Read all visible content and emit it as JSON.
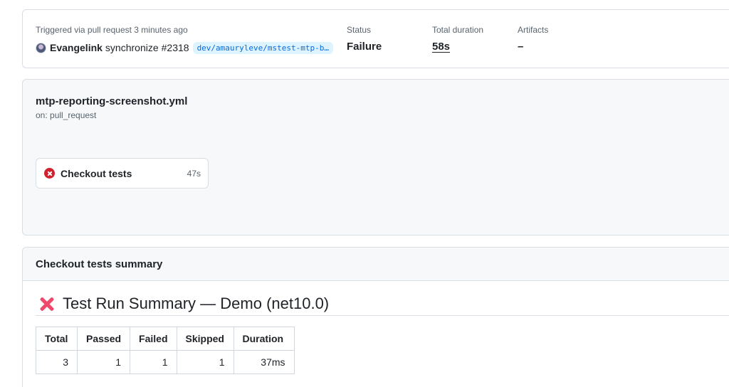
{
  "run": {
    "trigger_label": "Triggered via pull request 3 minutes ago",
    "actor": "Evangelink",
    "event": "synchronize",
    "pr_number": "#2318",
    "branch": "dev/amauryleve/mstest-mtp-b…",
    "status_label": "Status",
    "status_value": "Failure",
    "duration_label": "Total duration",
    "duration_value": "58s",
    "artifacts_label": "Artifacts",
    "artifacts_value": "–"
  },
  "workflow": {
    "file_name": "mtp-reporting-screenshot.yml",
    "trigger": "on: pull_request",
    "jobs": [
      {
        "name": "Checkout tests",
        "duration": "47s",
        "status": "failure",
        "icon": "x-circle-icon"
      }
    ]
  },
  "summary": {
    "header": "Checkout tests summary",
    "title": "Test Run Summary — Demo (net10.0)",
    "title_icon": "cross-mark-icon",
    "table": {
      "columns": [
        "Total",
        "Passed",
        "Failed",
        "Skipped",
        "Duration"
      ],
      "rows": [
        [
          "3",
          "1",
          "1",
          "1",
          "37ms"
        ]
      ]
    }
  },
  "colors": {
    "failure": "#cf222e",
    "cross_mark": "#f0486a",
    "link": "#0969da",
    "branch_bg": "#ddf4ff"
  }
}
